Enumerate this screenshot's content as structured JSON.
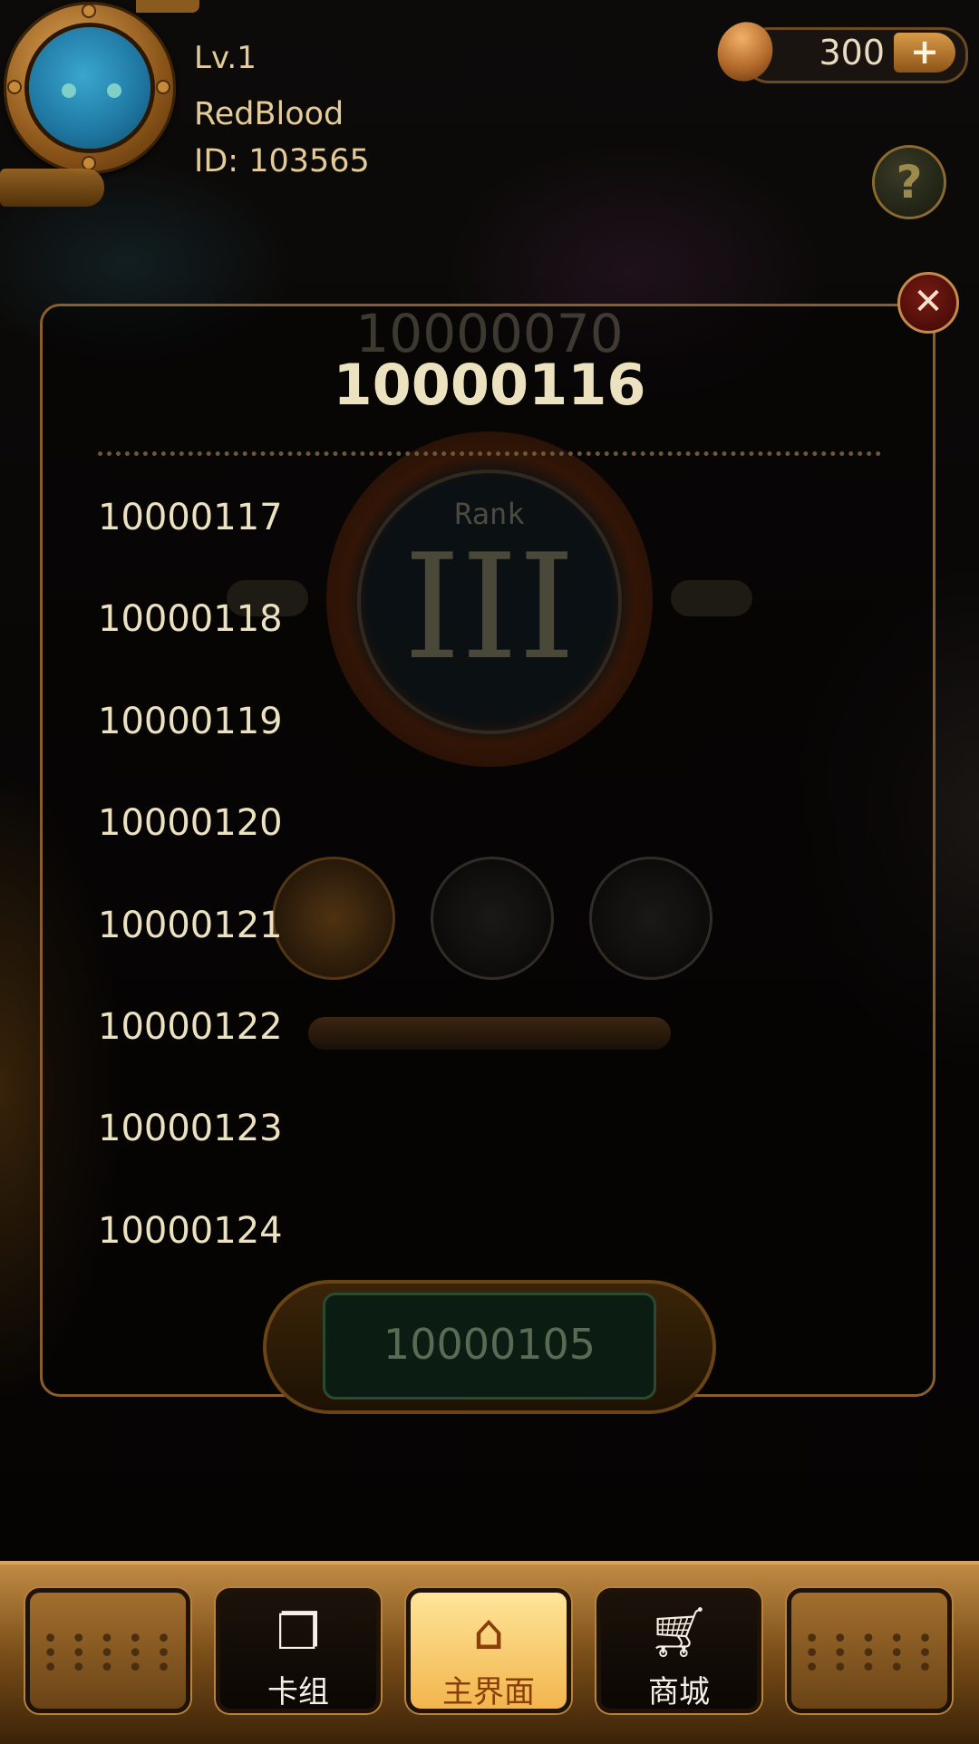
{
  "player": {
    "level": "Lv.1",
    "name": "RedBlood",
    "id": "ID: 103565"
  },
  "currency": {
    "amount": "300",
    "add_label": "+"
  },
  "help": {
    "label": "?"
  },
  "dialog": {
    "close_label": "✕",
    "previous_number": "10000070",
    "current_number": "10000116",
    "numbers": [
      "10000117",
      "10000118",
      "10000119",
      "10000120",
      "10000121",
      "10000122",
      "10000123",
      "10000124"
    ],
    "rank_word": "Rank",
    "rank_numeral": "III",
    "bottom_slot_number": "10000105"
  },
  "nav": {
    "items": [
      {
        "label": "",
        "icon": "dots-icon"
      },
      {
        "label": "卡组",
        "icon": "cards-icon"
      },
      {
        "label": "主界面",
        "icon": "home-icon"
      },
      {
        "label": "商城",
        "icon": "cart-icon"
      },
      {
        "label": "",
        "icon": "dots-icon"
      }
    ],
    "active_index": 2
  },
  "colors": {
    "accent_gold": "#e3cc98",
    "frame_bronze": "#8a5d2c",
    "active_tab": "#f2b54c"
  }
}
